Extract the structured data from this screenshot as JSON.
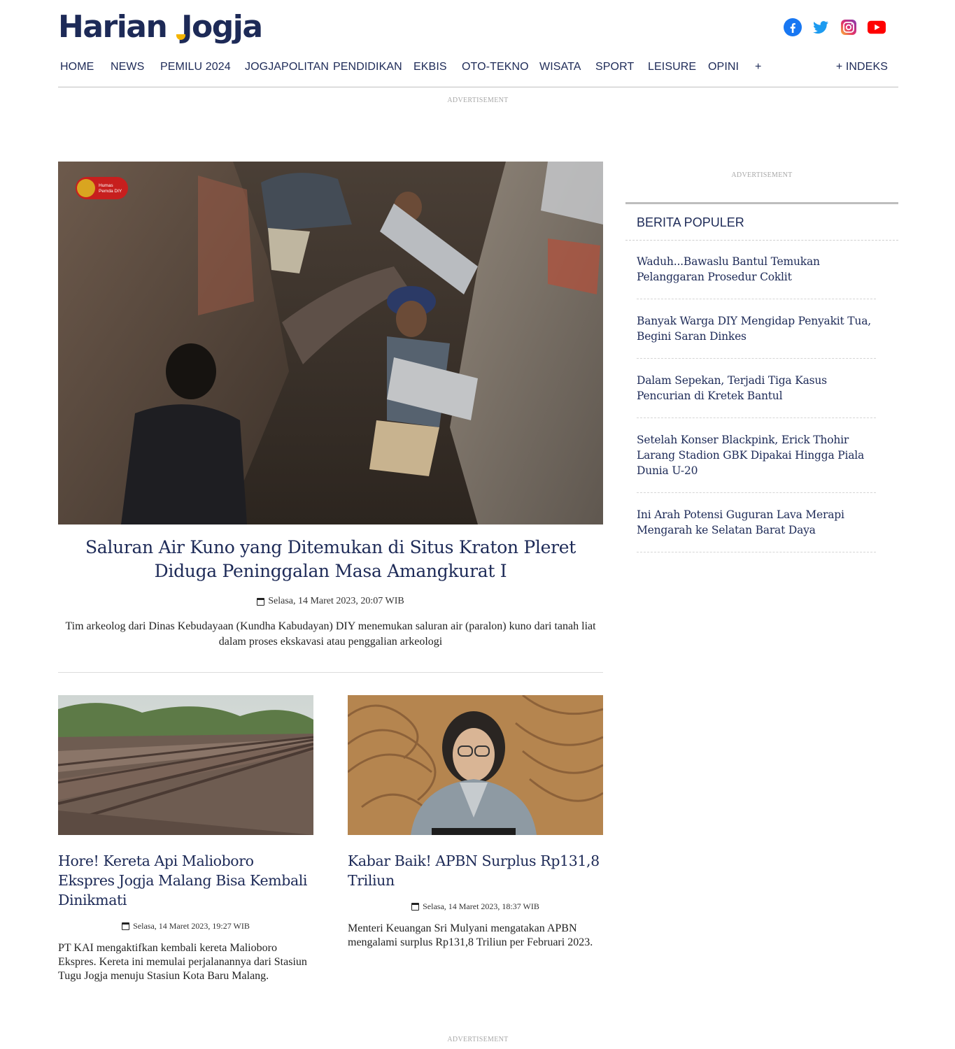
{
  "site": {
    "logo_part1": "Harian",
    "logo_part2": "Jogja",
    "socials": [
      "facebook-icon",
      "twitter-icon",
      "instagram-icon",
      "youtube-icon"
    ]
  },
  "nav": {
    "items": [
      "HOME",
      "NEWS",
      "PEMILU 2024",
      "JOGJAPOLITAN",
      "PENDIDIKAN",
      "EKBIS",
      "OTO-TEKNO",
      "WISATA",
      "SPORT",
      "LEISURE",
      "OPINI",
      "+"
    ],
    "indeks": "+ INDEKS"
  },
  "ads": {
    "label": "ADVERTISEMENT"
  },
  "hero": {
    "badge": "Humas Pemda DIY",
    "title": "Saluran Air Kuno yang Ditemukan di Situs Kraton Pleret Diduga Peninggalan Masa Amangkurat I",
    "date": "Selasa, 14 Maret 2023, 20:07 WIB",
    "description": "Tim arkeolog dari Dinas Kebudayaan (Kundha Kabudayan) DIY menemukan saluran air (paralon) kuno dari tanah liat dalam proses ekskavasi atau penggalian arkeologi"
  },
  "cards": [
    {
      "title": "Hore! Kereta Api Malioboro Ekspres Jogja Malang Bisa Kembali Dinikmati",
      "date": "Selasa, 14 Maret 2023, 19:27 WIB",
      "description": "PT KAI mengaktifkan kembali kereta Malioboro Ekspres. Kereta ini memulai perjalanannya dari Stasiun Tugu Jogja menuju Stasiun Kota Baru Malang."
    },
    {
      "title": "Kabar Baik! APBN Surplus Rp131,8 Triliun",
      "date": "Selasa, 14 Maret 2023, 18:37 WIB",
      "description": "Menteri Keuangan Sri Mulyani mengatakan APBN mengalami surplus Rp131,8 Triliun per Februari 2023."
    }
  ],
  "popular": {
    "heading": "BERITA POPULER",
    "items": [
      "Waduh...Bawaslu Bantul Temukan Pelanggaran Prosedur Coklit",
      "Banyak Warga DIY Mengidap Penyakit Tua, Begini Saran Dinkes",
      "Dalam Sepekan, Terjadi Tiga Kasus Pencurian di Kretek Bantul",
      "Setelah Konser Blackpink, Erick Thohir Larang Stadion GBK Dipakai Hingga Piala Dunia U-20",
      "Ini Arah Potensi Guguran Lava Merapi Mengarah ke Selatan Barat Daya"
    ]
  },
  "colors": {
    "brand_navy": "#1d2a57",
    "brand_yellow": "#f4b400",
    "facebook": "#1877f2",
    "twitter": "#1d9bf0",
    "youtube": "#ff0000"
  }
}
